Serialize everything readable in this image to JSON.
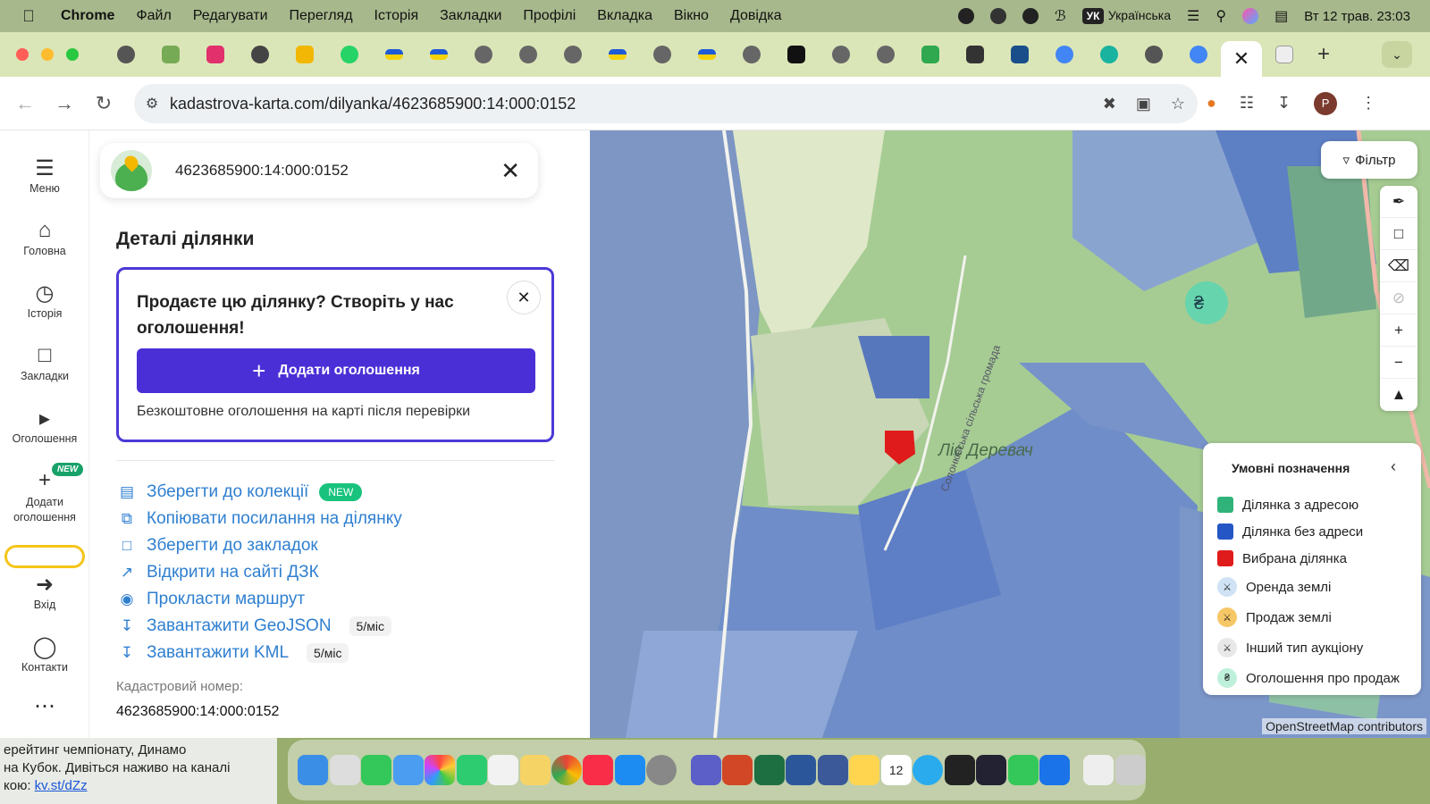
{
  "menubar": {
    "app": "Chrome",
    "items": [
      "Файл",
      "Редагувати",
      "Перегляд",
      "Історія",
      "Закладки",
      "Профілі",
      "Вкладка",
      "Вікно",
      "Довідка"
    ],
    "input_lang_code": "УК",
    "input_lang": "Українська",
    "datetime": "Вт 12 трав.  23:03"
  },
  "browser": {
    "url": "kadastrova-karta.com/dilyanka/4623685900:14:000:0152",
    "active_tab_close": "✕",
    "avatar_letter": "P"
  },
  "sidenav": {
    "menu": "Меню",
    "home": "Головна",
    "history": "Історія",
    "bookmarks": "Закладки",
    "ads": "Оголошення",
    "add_ad": "Додати оголошення",
    "new_badge": "NEW",
    "login": "Вхід",
    "contacts": "Контакти"
  },
  "search": {
    "cadastral_number": "4623685900:14:000:0152"
  },
  "details": {
    "title": "Деталі ділянки",
    "promo_title": "Продаєте цю ділянку? Створіть у нас оголошення!",
    "promo_button": "Додати оголошення",
    "promo_sub": "Безкоштовне оголошення на карті після перевірки"
  },
  "actions": [
    {
      "label": "Зберегти до колекції",
      "badge": "NEW"
    },
    {
      "label": "Копіювати посилання на ділянку"
    },
    {
      "label": "Зберегти до закладок"
    },
    {
      "label": "Відкрити на сайті ДЗК"
    },
    {
      "label": "Прокласти маршрут"
    },
    {
      "label": "Завантажити GeoJSON",
      "limit": "5/міс"
    },
    {
      "label": "Завантажити KML",
      "limit": "5/міс"
    }
  ],
  "cadastral": {
    "label": "Кадастровий номер:",
    "value": "4623685900:14:000:0152"
  },
  "map": {
    "filter": "Фільтр",
    "forest_label": "Ліс Деревач",
    "road_label": "Солонківська сільська громада",
    "attribution": "OpenStreetMap contributors",
    "legend_title": "Умовні позначення",
    "legend": [
      {
        "label": "Ділянка з адресою",
        "color": "#2fb37a"
      },
      {
        "label": "Ділянка без адреси",
        "color": "#2457c5"
      },
      {
        "label": "Вибрана ділянка",
        "color": "#e01b1b"
      },
      {
        "label": "Оренда землі",
        "color": "#cfe3f5"
      },
      {
        "label": "Продаж землі",
        "color": "#f6c766"
      },
      {
        "label": "Інший тип аукціону",
        "color": "#e8e8e8"
      },
      {
        "label": "Оголошення про продаж",
        "color": "#bff0dc"
      }
    ]
  },
  "desktop": {
    "notice_line1": "ерейтинг чемпіонату, Динамо",
    "notice_line2": "на Кубок. Дивіться наживо на каналі",
    "notice_prefix": "кою: ",
    "notice_link": "kv.st/dZz",
    "dock_calendar_day": "12"
  }
}
